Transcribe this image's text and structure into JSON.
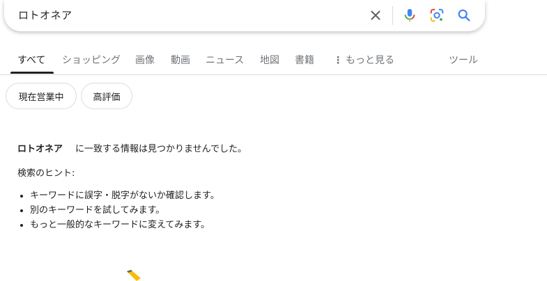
{
  "search": {
    "query": "ロトオネア",
    "icons": [
      "close-icon",
      "microphone-icon",
      "google-lens-icon",
      "search-icon"
    ]
  },
  "tabs": [
    {
      "label": "すべて",
      "active": true
    },
    {
      "label": "ショッピング"
    },
    {
      "label": "画像"
    },
    {
      "label": "動画"
    },
    {
      "label": "ニュース"
    },
    {
      "label": "地図"
    },
    {
      "label": "書籍"
    },
    {
      "label": "もっと見る"
    },
    {
      "label": "ツール"
    }
  ],
  "chips": [
    {
      "label": "現在営業中"
    },
    {
      "label": "高評価"
    }
  ],
  "results": {
    "query_bold": "ロトオネア",
    "no_match_text": "に一致する情報は見つかりませんでした。",
    "hint_title": "検索のヒント:",
    "hints": [
      "キーワードに誤字・脱字がないか確認します。",
      "別のキーワードを試してみます。",
      "もっと一般的なキーワードに変えてみます。"
    ]
  },
  "colors": {
    "mic_blue": "#4285f4",
    "mic_red": "#ea4335",
    "lens_yellow": "#fbbc05",
    "lens_green": "#34a853",
    "search_blue": "#4285f4"
  }
}
